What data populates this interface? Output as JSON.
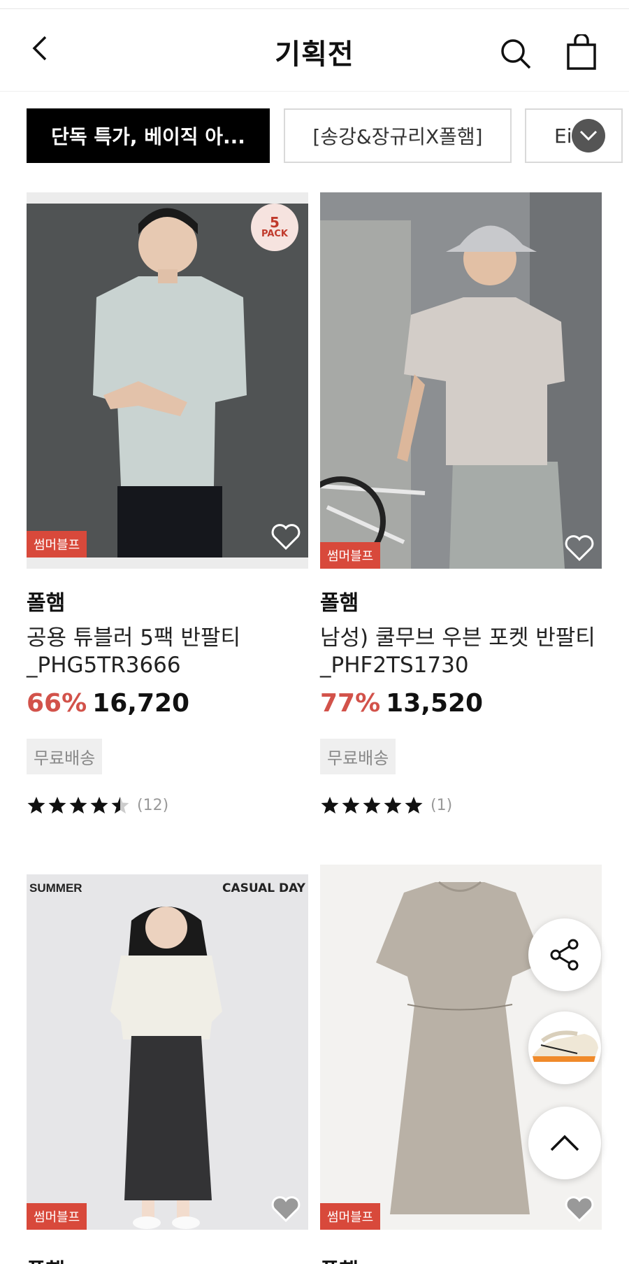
{
  "header": {
    "title": "기획전",
    "back_icon": "chevron-left-icon",
    "search_icon": "search-icon",
    "bag_icon": "shopping-bag-icon"
  },
  "tabs": [
    {
      "label": "단독 특가, 베이직 아...",
      "active": true
    },
    {
      "label": "[송강&장규리X폴햄]",
      "active": false
    },
    {
      "label": "Ei",
      "active": false
    }
  ],
  "tabs_more_icon": "chevron-down-icon",
  "products": [
    {
      "image_bg": "#505354",
      "pack_badge": {
        "line1": "5",
        "line2": "PACK"
      },
      "tag": "썸머블프",
      "brand": "폴햄",
      "name_line1": "공용 튜블러 5팩 반팔티",
      "name_line2": "_PHG5TR3666",
      "discount": "66%",
      "price": "16,720",
      "shipping": "무료배송",
      "rating": 4.5,
      "review_count": "(12)"
    },
    {
      "image_bg": "#8c8f92",
      "tag": "썸머블프",
      "brand": "폴햄",
      "name_line1": "남성) 쿨무브 우븐 포켓 반팔티",
      "name_line2": "_PHF2TS1730",
      "discount": "77%",
      "price": "13,520",
      "shipping": "무료배송",
      "rating": 5,
      "review_count": "(1)"
    },
    {
      "image_bg": "#e6e6e8",
      "corner_left": "SUMMER",
      "corner_right": "CASUAL DAY",
      "tag": "썸머블프",
      "brand": "폴햄"
    },
    {
      "image_bg": "#f3f2f0",
      "tag": "썸머블프",
      "brand": "폴햄"
    }
  ],
  "floating": {
    "share_icon": "share-icon",
    "recent_item_icon": "sneaker-thumbnail",
    "top_icon": "chevron-up-icon"
  },
  "colors": {
    "accent_red": "#d2524a",
    "tag_red": "#d8493b",
    "active_tab": "#000000"
  }
}
